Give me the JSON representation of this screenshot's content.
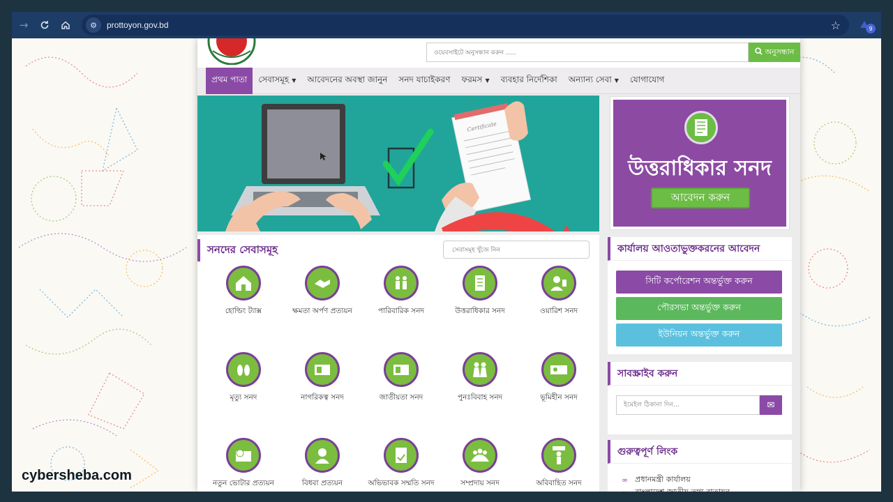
{
  "browser": {
    "url": "prottoyon.gov.bd",
    "extension_badge": "9"
  },
  "header": {
    "search_placeholder": "ওয়েবসাইটে অনুসন্ধান করুন ......",
    "search_button": "অনুসন্ধান"
  },
  "nav": {
    "items": [
      {
        "label": "প্রথম পাতা",
        "active": true,
        "dropdown": false
      },
      {
        "label": "সেবাসমূহ",
        "active": false,
        "dropdown": true
      },
      {
        "label": "আবেদনের অবস্থা জানুন",
        "active": false,
        "dropdown": false
      },
      {
        "label": "সনদ যাচাইকরণ",
        "active": false,
        "dropdown": false
      },
      {
        "label": "ফরমস",
        "active": false,
        "dropdown": true
      },
      {
        "label": "ব্যবহার নির্দেশিকা",
        "active": false,
        "dropdown": false
      },
      {
        "label": "অন্যান্য সেবা",
        "active": false,
        "dropdown": true
      },
      {
        "label": "যোগাযোগ",
        "active": false,
        "dropdown": false
      }
    ]
  },
  "banner": {
    "certificate_text": "Certificate"
  },
  "ad": {
    "title": "উত্তরাধিকার সনদ",
    "button": "আবেদন করুন"
  },
  "services": {
    "title": "সনদের সেবাসমূহ",
    "search_placeholder": "সেবাসমূহ খুঁজে নিন",
    "items": [
      {
        "label": "হোল্ডিং ট্যাক্স",
        "icon": "house-icon"
      },
      {
        "label": "ক্ষমতা অর্পণ প্রত্যয়ন",
        "icon": "handshake-icon"
      },
      {
        "label": "পারিবারিক সনদ",
        "icon": "family-icon"
      },
      {
        "label": "উত্তরাধিকার সনদ",
        "icon": "document-icon"
      },
      {
        "label": "ওয়ারিশ সনদ",
        "icon": "person-icon"
      },
      {
        "label": "মৃত্যু সনদ",
        "icon": "footprint-icon"
      },
      {
        "label": "নাগরিকত্ব সনদ",
        "icon": "id-card-icon"
      },
      {
        "label": "জাতীয়তা সনদ",
        "icon": "id-card-icon"
      },
      {
        "label": "পুনঃবিবাহ সনদ",
        "icon": "couple-icon"
      },
      {
        "label": "ভূমিহীন সনদ",
        "icon": "land-icon"
      },
      {
        "label": "নতুন ভোটার প্রত্যয়ন",
        "icon": "voter-card-icon"
      },
      {
        "label": "বিধবা প্রত্যয়ন",
        "icon": "woman-icon"
      },
      {
        "label": "অভিভাবক সম্মতি সনদ",
        "icon": "consent-icon"
      },
      {
        "label": "সম্প্রদায় সনদ",
        "icon": "community-icon"
      },
      {
        "label": "অবিবাহিত সনদ",
        "icon": "single-person-icon"
      }
    ]
  },
  "office": {
    "title": "কার্যালয় আওতাভুক্তকরনের আবেদন",
    "buttons": [
      {
        "label": "সিটি কর্পোরেশন অন্তর্ভুক্ত করুন",
        "color": "#8a4aa6"
      },
      {
        "label": "পৌরসভা অন্তর্ভুক্ত করুন",
        "color": "#5cb85c"
      },
      {
        "label": "ইউনিয়ন অন্তর্ভুক্ত করুন",
        "color": "#5bc0de"
      }
    ]
  },
  "subscribe": {
    "title": "সাবস্ক্রাইব করুন",
    "email_placeholder": "ইমেইল ঠিকানা দিন..."
  },
  "links": {
    "title": "গুরুত্বপূর্ণ লিংক",
    "items": [
      "প্রধানমন্ত্রী কার্যালয়",
      "বাংলাদেশ জাতীয় তথ্য বাতায়ন"
    ]
  },
  "watermark": "cybersheba.com",
  "colors": {
    "primary_purple": "#8a4aa6",
    "accent_green": "#6cbd45",
    "banner_teal": "#21a59b",
    "arrow_red": "#ef4444"
  }
}
